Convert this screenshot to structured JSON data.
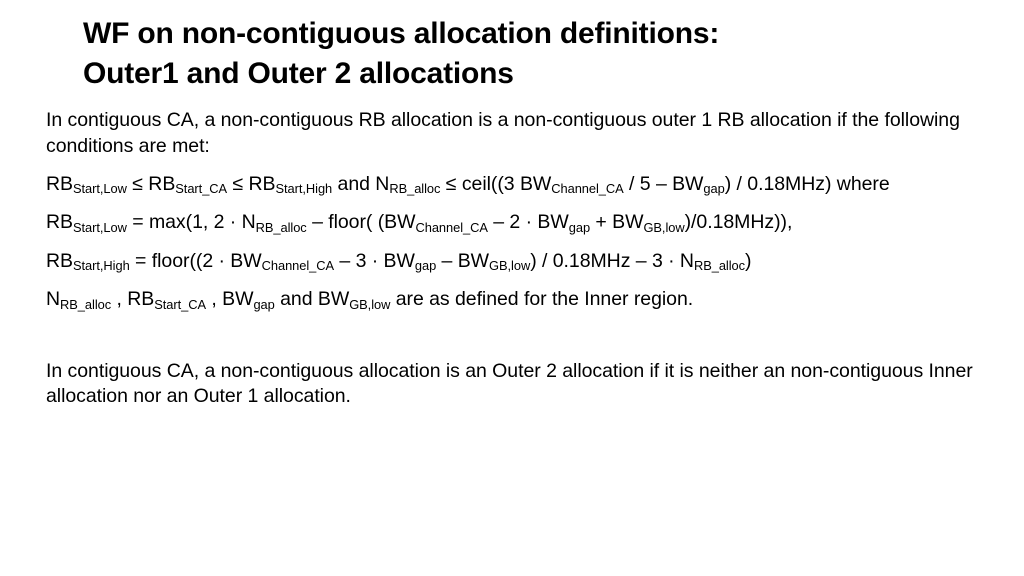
{
  "slide": {
    "background_color": "#ffffff",
    "text_color": "#000000",
    "title": {
      "line1": "WF on non-contiguous allocation definitions:",
      "line2": "Outer1 and Outer 2 allocations"
    },
    "paragraphs": {
      "intro_line1": "In contiguous CA, a non-contiguous RB allocation is a non-contiguous outer 1 RB allocation",
      "intro_line2": "if the following conditions are met:",
      "where": "where",
      "defined_tail": " are as defined for the Inner region.",
      "outer2_line1": "In contiguous CA, a non-contiguous allocation is an Outer 2 allocation if it is neither an",
      "outer2_line2": "non-contiguous Inner allocation nor an Outer 1 allocation."
    },
    "formulas": {
      "condition": {
        "sym_rb": "RB",
        "sub_start_low": "Start,Low",
        "le1": "≤",
        "sub_start_ca": "Start_CA",
        "le2": "≤",
        "sub_start_high": "Start,High",
        "and": "and",
        "sym_n": "N",
        "sub_rb_alloc": "RB_alloc",
        "le3": "≤",
        "ceil_open": "ceil((3 BW",
        "sub_channel_ca": "Channel_CA",
        "mid": " / 5 – BW",
        "sub_gap": "gap",
        "tail": ") / 0.18MHz)"
      },
      "rb_start_low": {
        "lhs_sym": "RB",
        "lhs_sub": "Start,Low",
        "eq": " = max(1, 2 · N",
        "sub_rb_alloc": "RB_alloc",
        "seg2": " – floor( (BW",
        "sub_channel_ca": "Channel_CA",
        "seg3": " – 2 · BW",
        "sub_gap": "gap",
        "seg4": " + BW",
        "sub_gb_low": "GB,low",
        "tail": ")/0.18MHz)),"
      },
      "rb_start_high": {
        "lhs_sym": "RB",
        "lhs_sub": "Start,High",
        "eq": " = floor((2 · BW",
        "sub_channel_ca": "Channel_CA",
        "seg2": " – 3 · BW",
        "sub_gap": "gap",
        "seg3": " – BW",
        "sub_gb_low": "GB,low",
        "seg4": ") / 0.18MHz – 3 · N",
        "sub_rb_alloc": "RB_alloc",
        "tail": ")"
      },
      "defined_list": {
        "sym_n": "N",
        "sub_rb_alloc": "RB_alloc",
        "comma1": " , ",
        "sym_rb": "RB",
        "sub_start_ca": "Start_CA",
        "comma2": " , ",
        "sym_bw1": "BW",
        "sub_gap": "gap",
        "and": " and ",
        "sym_bw2": "BW",
        "sub_gb_low": "GB,low"
      }
    }
  }
}
